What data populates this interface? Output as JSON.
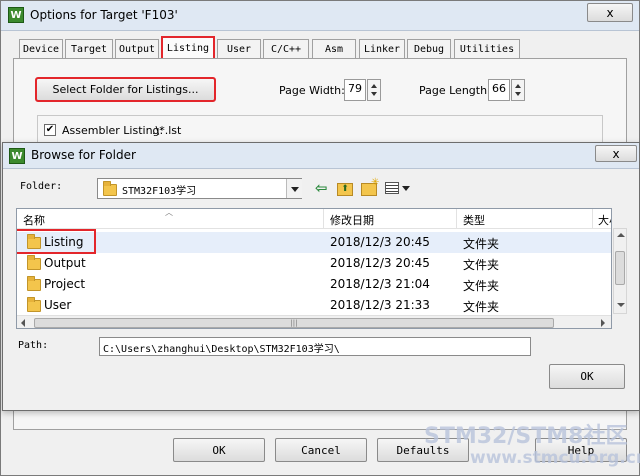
{
  "options_window": {
    "title": "Options for Target 'F103'",
    "close": "x",
    "tabs": [
      "Device",
      "Target",
      "Output",
      "Listing",
      "User",
      "C/C++",
      "Asm",
      "Linker",
      "Debug",
      "Utilities"
    ],
    "select_folder_label": "Select Folder for Listings...",
    "page_width_label": "Page Width:",
    "page_width_value": "79",
    "page_length_label": "Page Length:",
    "page_length_value": "66",
    "assembler_label": "Assembler Listing:",
    "assembler_path": ".\\*.lst",
    "bottom_buttons": {
      "ok": "OK",
      "cancel": "Cancel",
      "defaults": "Defaults",
      "help": "Help"
    }
  },
  "browse_dialog": {
    "title": "Browse for Folder",
    "close": "x",
    "folder_label": "Folder:",
    "folder_value": "STM32F103学习",
    "columns": {
      "name": "名称",
      "modified": "修改日期",
      "type": "类型",
      "size": "大小"
    },
    "rows": [
      {
        "name": "Listing",
        "modified": "2018/12/3 20:45",
        "type": "文件夹"
      },
      {
        "name": "Output",
        "modified": "2018/12/3 20:45",
        "type": "文件夹"
      },
      {
        "name": "Project",
        "modified": "2018/12/3 21:04",
        "type": "文件夹"
      },
      {
        "name": "User",
        "modified": "2018/12/3 21:33",
        "type": "文件夹"
      }
    ],
    "path_label": "Path:",
    "path_value": "C:\\Users\\zhanghui\\Desktop\\STM32F103学习\\",
    "ok": "OK"
  },
  "watermark": {
    "line1": "STM32/STM8社区",
    "line2": "www.stmcu.org.cn"
  },
  "colors": {
    "highlight_red": "#e3262b",
    "selection": "#e6eefa",
    "keil_green": "#3c8a2e"
  }
}
